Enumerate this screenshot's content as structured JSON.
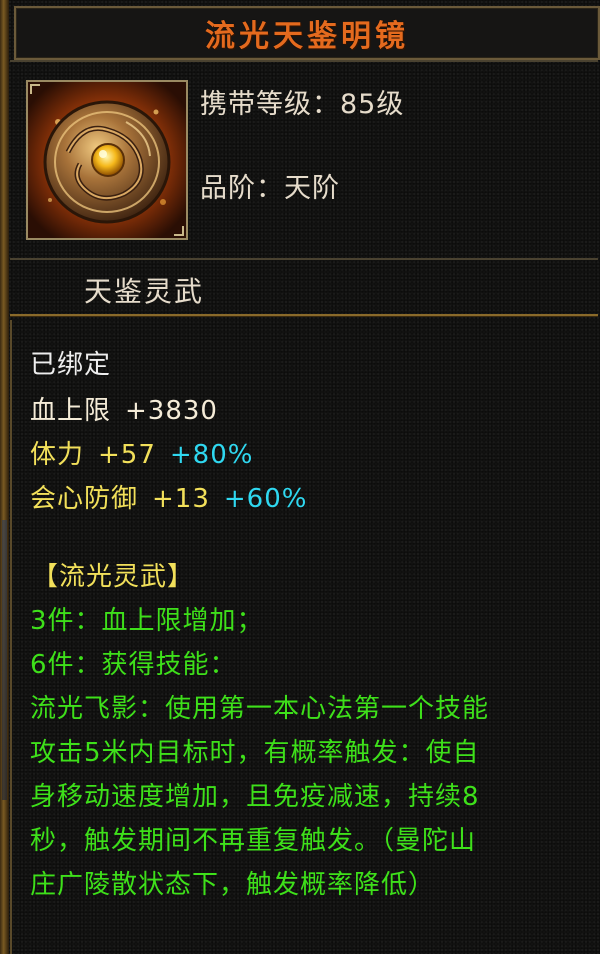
{
  "item": {
    "name": "流光天鉴明镜",
    "icon": "bronze-mirror-icon",
    "level_label": "携带等级：",
    "level_value": "85级",
    "grade_label": "品阶：",
    "grade_value": "天阶",
    "category": "天鉴灵武"
  },
  "attributes": {
    "bound": "已绑定",
    "hp": {
      "label": "血上限",
      "value": "+3830"
    },
    "stamina": {
      "label": "体力",
      "value": "+57",
      "bonus": "+80%"
    },
    "crit_def": {
      "label": "会心防御",
      "value": "+13",
      "bonus": "+60%"
    }
  },
  "set": {
    "name": "【流光灵武】",
    "lines": [
      "3件：血上限增加；",
      "6件：获得技能：",
      "流光飞影：使用第一本心法第一个技能",
      "攻击5米内目标时，有概率触发：使自",
      "身移动速度增加，且免疫减速，持续8",
      "秒，触发期间不再重复触发。（曼陀山",
      "庄广陵散状态下，触发概率降低）"
    ]
  },
  "colors": {
    "title": "#e46a1e",
    "normal": "#e6dccb",
    "yellow": "#f2e05a",
    "cyan": "#2fd8f0",
    "green": "#3ee01a"
  }
}
